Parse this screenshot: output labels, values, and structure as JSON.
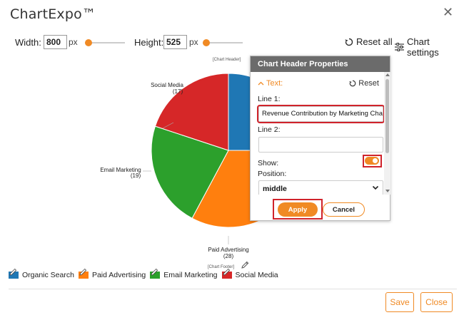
{
  "app": {
    "title": "ChartExpo™"
  },
  "toolbar": {
    "width_label": "Width:",
    "width_value": "800",
    "height_label": "Height:",
    "height_value": "525",
    "unit": "px",
    "reset_all": "Reset all",
    "chart_settings": "Chart settings"
  },
  "chart": {
    "header_placeholder": "[Chart Header]",
    "footer_placeholder": "[Chart Footer]"
  },
  "chart_data": {
    "type": "pie",
    "categories": [
      "Organic Search",
      "Paid Advertising",
      "Email Marketing",
      "Social Media"
    ],
    "values": [
      null,
      28,
      19,
      17
    ],
    "colors": [
      "#1f77b4",
      "#ff7f0e",
      "#2ca02c",
      "#d62728"
    ],
    "labels_visible": [
      {
        "name": "Social Media",
        "value": "(17)"
      },
      {
        "name": "Email Marketing",
        "value": "(19)"
      },
      {
        "name": "Paid Advertising",
        "value": "(28)"
      }
    ],
    "legend_placement": "bottom-left"
  },
  "legend": [
    {
      "label": "Organic Search",
      "color": "#1f77b4"
    },
    {
      "label": "Paid Advertising",
      "color": "#ff7f0e"
    },
    {
      "label": "Email Marketing",
      "color": "#2ca02c"
    },
    {
      "label": "Social Media",
      "color": "#d62728"
    }
  ],
  "panel": {
    "title": "Chart Header Properties",
    "section": "Text:",
    "reset": "Reset",
    "line1_label": "Line 1:",
    "line1_value": "Revenue Contribution by Marketing Char",
    "line2_label": "Line 2:",
    "line2_value": "",
    "show_label": "Show:",
    "show_on": true,
    "position_label": "Position:",
    "position_value": "middle",
    "apply": "Apply",
    "cancel": "Cancel"
  },
  "footer": {
    "save": "Save",
    "close": "Close"
  },
  "colors": {
    "accent": "#f08a24",
    "highlight": "#d0232b",
    "panel_header": "#6b6b6b"
  }
}
